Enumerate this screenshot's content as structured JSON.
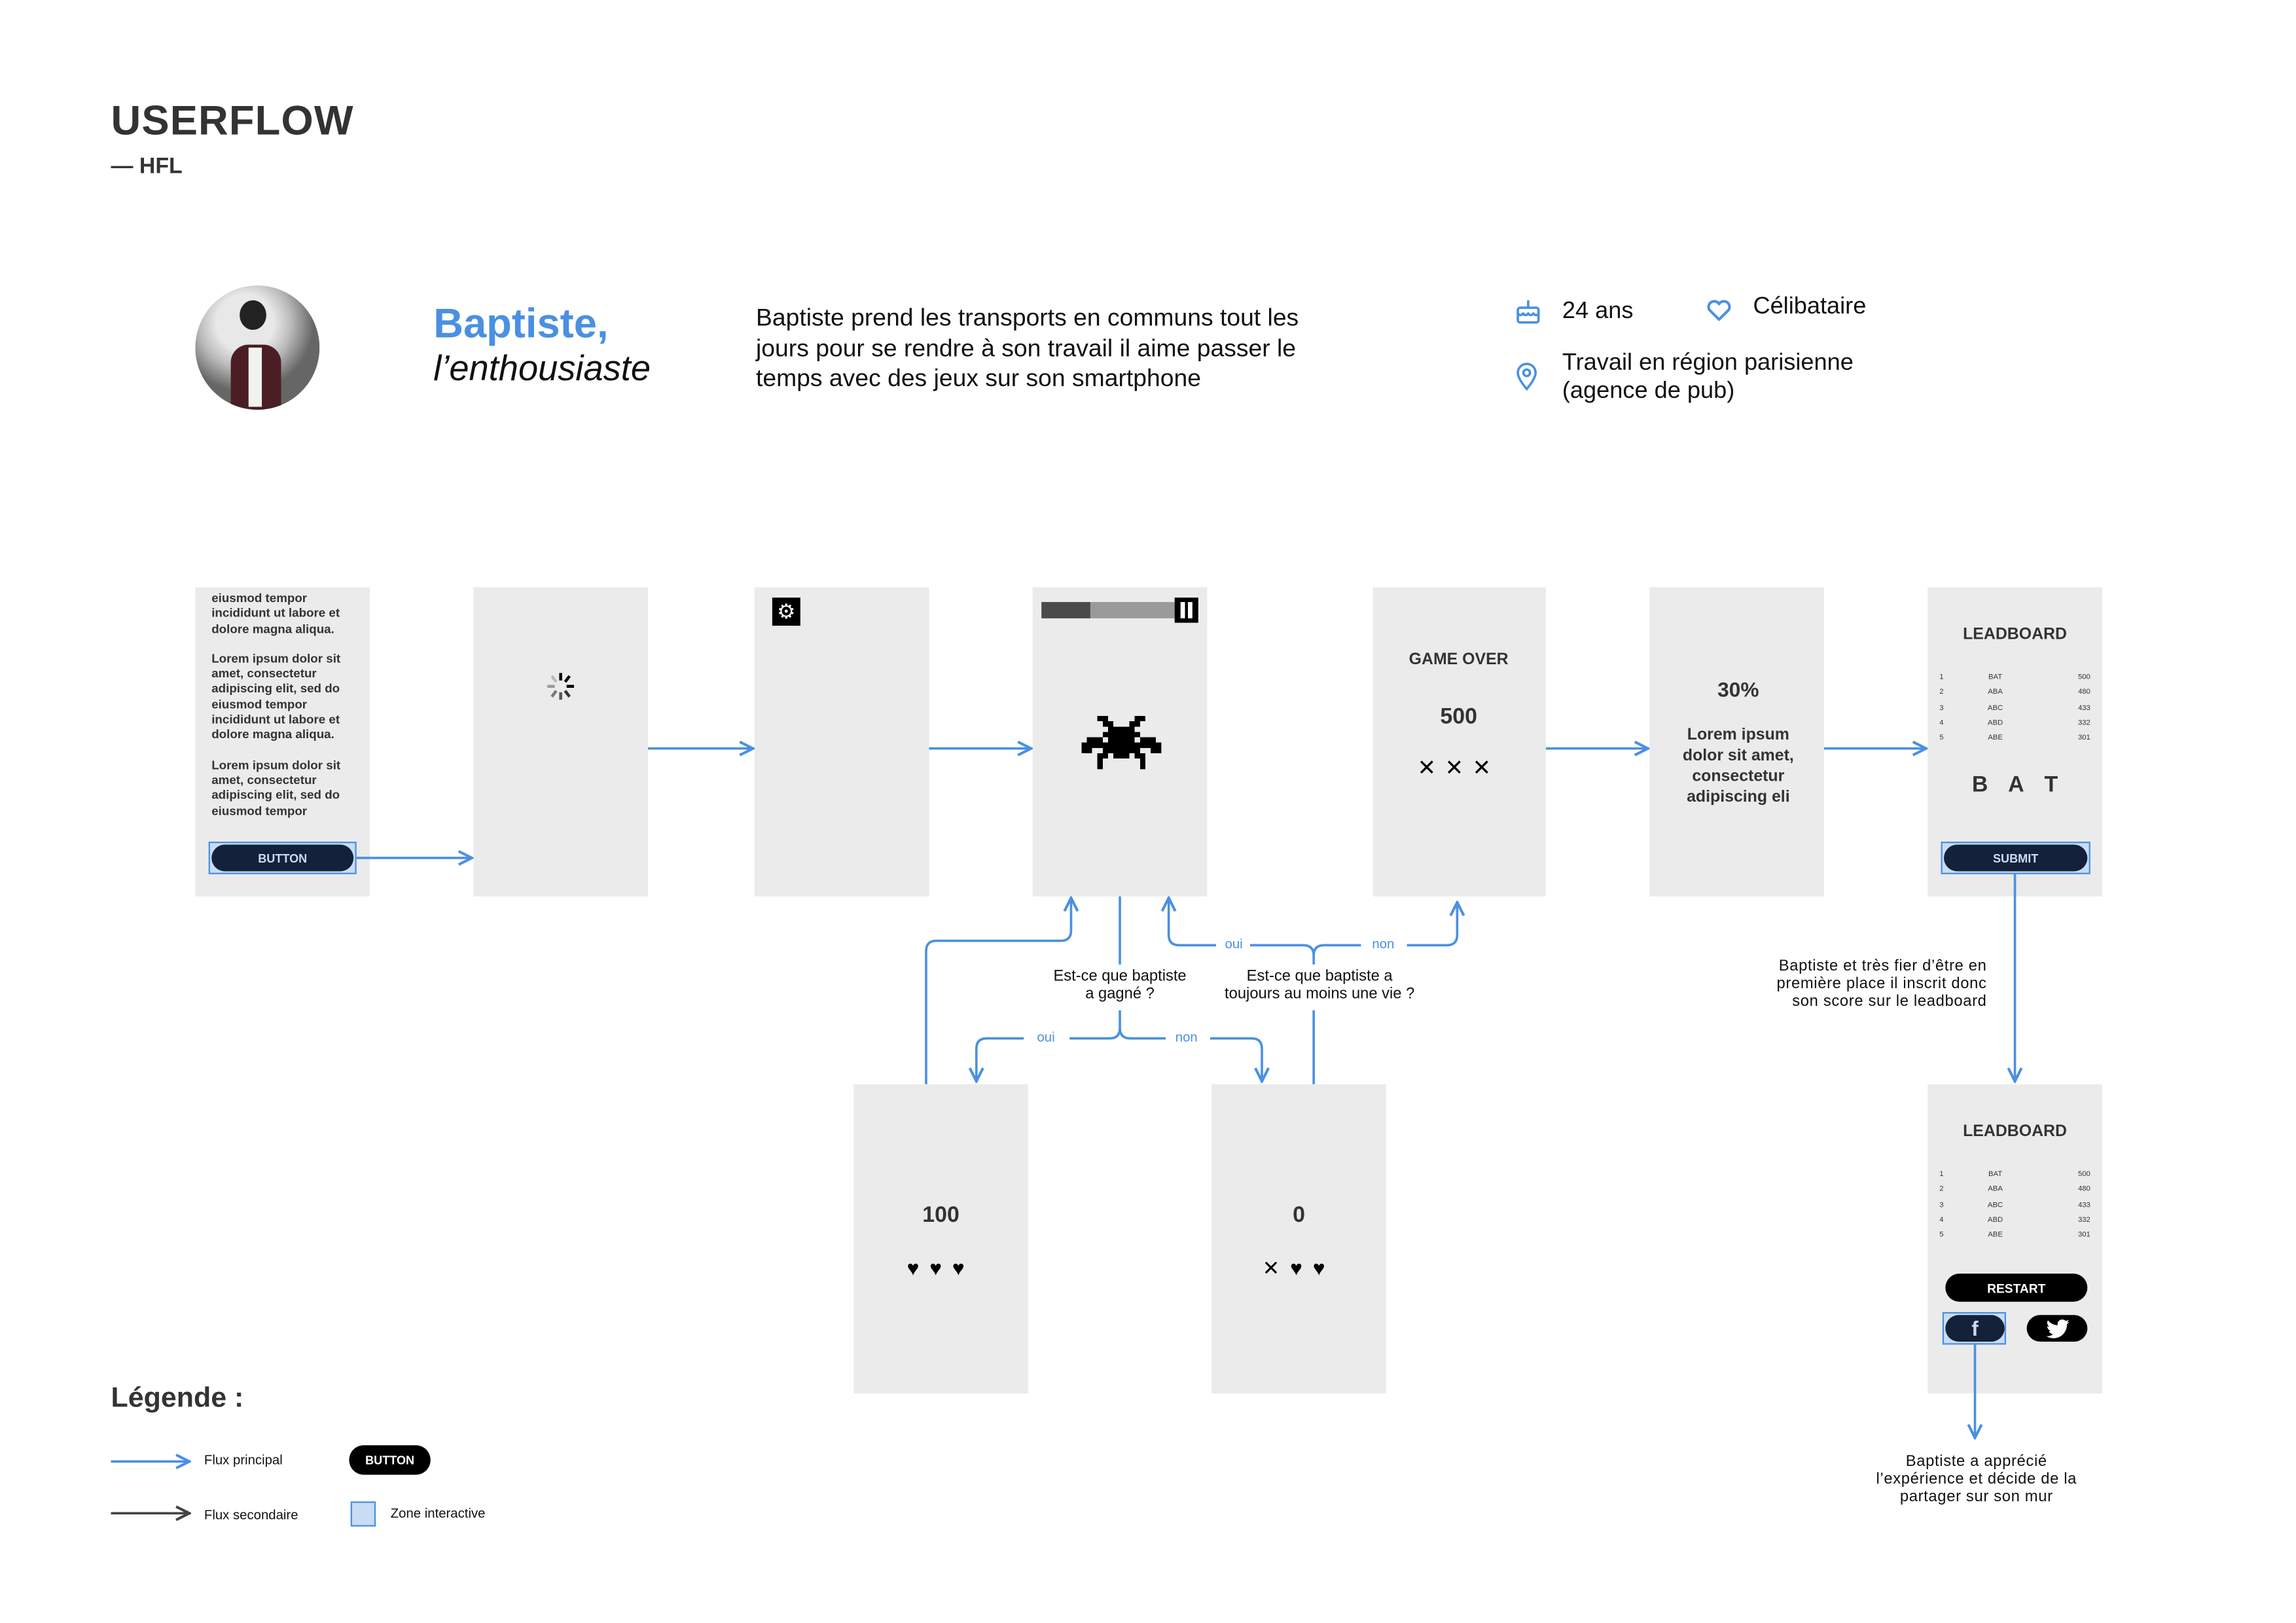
{
  "header": {
    "title": "USERFLOW",
    "subtitle": "— HFL"
  },
  "persona": {
    "name": "Baptiste,",
    "tagline": "l’enthousiaste",
    "description_lines": [
      "Baptiste prend les transports en communs tout les",
      "jours pour se rendre à son travail il aime passer le",
      "temps avec des jeux sur son smartphone"
    ],
    "age": "24 ans",
    "status": "Célibataire",
    "work_line1": "Travail en région parisienne",
    "work_line2": "(agence de pub)",
    "icons": [
      "cake-icon",
      "heart-icon",
      "location-pin-icon"
    ]
  },
  "colors": {
    "accent": "#4a90e2",
    "screen": "#ebebeb",
    "button_dark": "#14213a",
    "highlight": "#c9dcf3",
    "secondary_flow": "#444444"
  },
  "screens": {
    "intro": {
      "lines_p1": [
        "eiusmod tempor",
        "incididunt ut labore et",
        "dolore magna aliqua."
      ],
      "lines_p2": [
        "Lorem ipsum dolor sit",
        "amet, consectetur",
        "adipiscing elit, sed do",
        "eiusmod tempor",
        "incididunt ut labore et",
        "dolore magna aliqua."
      ],
      "lines_p3": [
        "Lorem ipsum dolor sit",
        "amet, consectetur",
        "adipiscing elit, sed do",
        "eiusmod tempor"
      ],
      "button": "BUTTON"
    },
    "loading": {
      "icon": "spinner-icon"
    },
    "settings": {
      "icon": "gear-icon"
    },
    "game": {
      "progress_percent": 37,
      "icons": [
        "pause-icon",
        "space-invader-icon"
      ]
    },
    "game_over": {
      "title": "GAME OVER",
      "score": "500",
      "lives": [
        "x",
        "x",
        "x"
      ]
    },
    "progress": {
      "percent": "30%",
      "lines": [
        "Lorem ipsum",
        "dolor sit amet,",
        "consectetur",
        "adipiscing eli"
      ]
    },
    "leaderboard_entry": {
      "title": "LEADBOARD",
      "initials": [
        "B",
        "A",
        "T"
      ],
      "button": "SUBMIT"
    },
    "win": {
      "score": "100",
      "lives": [
        "heart",
        "heart",
        "heart"
      ]
    },
    "lose": {
      "score": "0",
      "lives": [
        "x",
        "heart",
        "heart"
      ]
    },
    "leaderboard_final": {
      "title": "LEADBOARD",
      "restart": "RESTART",
      "share": [
        "facebook-icon",
        "twitter-icon"
      ]
    }
  },
  "leaderboard_rows": [
    {
      "rank": "1",
      "name": "BAT",
      "score": "500"
    },
    {
      "rank": "2",
      "name": "ABA",
      "score": "480"
    },
    {
      "rank": "3",
      "name": "ABC",
      "score": "433"
    },
    {
      "rank": "4",
      "name": "ABD",
      "score": "332"
    },
    {
      "rank": "5",
      "name": "ABE",
      "score": "301"
    }
  ],
  "decisions": {
    "won_lines": [
      "Est-ce que baptiste",
      "a gagné ?"
    ],
    "lives_lines": [
      "Est-ce que baptiste a",
      "toujours au moins une vie ?"
    ],
    "yes": "oui",
    "no": "non"
  },
  "annotations": {
    "submit_lines": [
      "Baptiste et très fier d’être en",
      "première place il inscrit donc",
      "son score sur le leadboard"
    ],
    "share_lines": [
      "Baptiste a apprécié",
      "l’expérience et décide de la",
      "partager sur son mur"
    ]
  },
  "legend": {
    "title": "Légende :",
    "main_flow": "Flux principal",
    "secondary_flow": "Flux secondaire",
    "button_sample": "BUTTON",
    "interactive_zone": "Zone interactive"
  }
}
